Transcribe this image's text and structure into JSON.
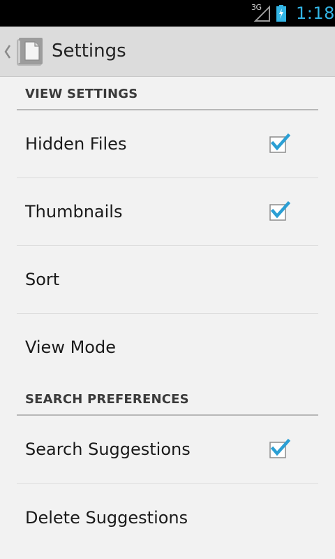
{
  "status_bar": {
    "network": "3G",
    "time": "1:18"
  },
  "action_bar": {
    "title": "Settings",
    "up_icon": "chevron-left-icon",
    "app_icon": "document-icon"
  },
  "sections": [
    {
      "header": "VIEW SETTINGS",
      "items": [
        {
          "label": "Hidden Files",
          "checked": true
        },
        {
          "label": "Thumbnails",
          "checked": true
        },
        {
          "label": "Sort",
          "checked": null
        },
        {
          "label": "View Mode",
          "checked": null
        }
      ]
    },
    {
      "header": "SEARCH PREFERENCES",
      "items": [
        {
          "label": "Search Suggestions",
          "checked": true
        },
        {
          "label": "Delete Suggestions",
          "checked": null
        }
      ]
    }
  ],
  "colors": {
    "accent": "#33b5e5",
    "check_mark": "#2b9fd4"
  }
}
